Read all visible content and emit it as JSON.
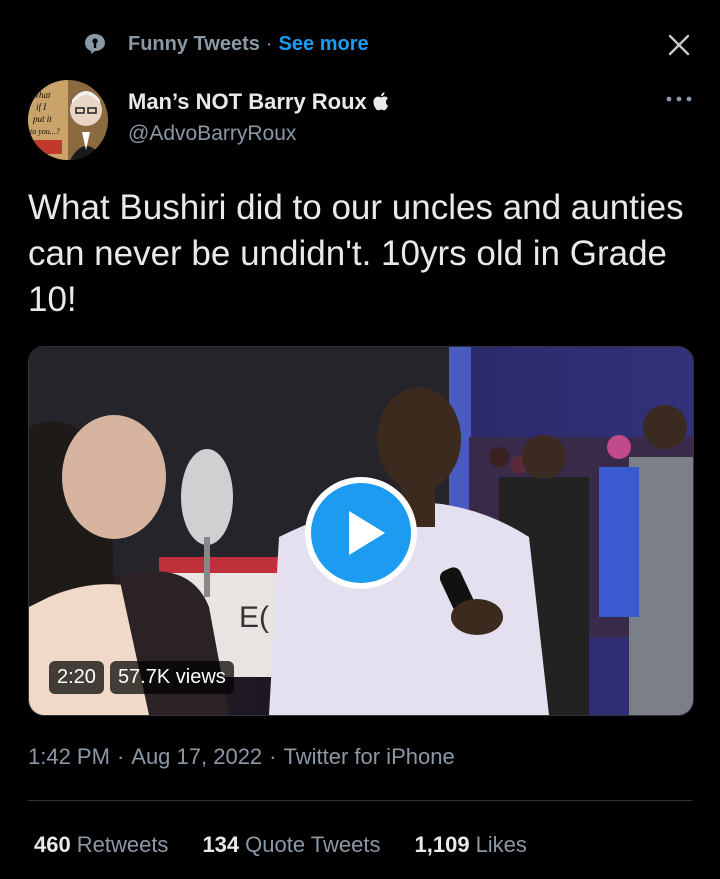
{
  "topic": {
    "name": "Funny Tweets",
    "separator": "·",
    "see_more": "See more"
  },
  "author": {
    "display_name": "Man’s NOT Barry Roux",
    "handle": "@AdvoBarryRoux",
    "avatar_caption": "what if I put it to you...?"
  },
  "tweet": {
    "text": "What Bushiri did to our uncles and aunties can never be undidn't. 10yrs old in Grade 10!"
  },
  "video": {
    "duration": "2:20",
    "views": "57.7K views"
  },
  "meta": {
    "time": "1:42 PM",
    "date": "Aug 17, 2022",
    "source": "Twitter for iPhone",
    "separator": "·"
  },
  "stats": {
    "retweets_count": "460",
    "retweets_label": "Retweets",
    "quotes_count": "134",
    "quotes_label": "Quote Tweets",
    "likes_count": "1,109",
    "likes_label": "Likes"
  },
  "colors": {
    "background": "#000000",
    "accent": "#1d9bf0",
    "secondary_text": "#8b98a5",
    "primary_text": "#e7e9ea",
    "play_button": "#1d9bf0"
  },
  "icons": [
    "topic-icon",
    "close-icon",
    "apple-icon",
    "more-icon",
    "play-icon"
  ]
}
